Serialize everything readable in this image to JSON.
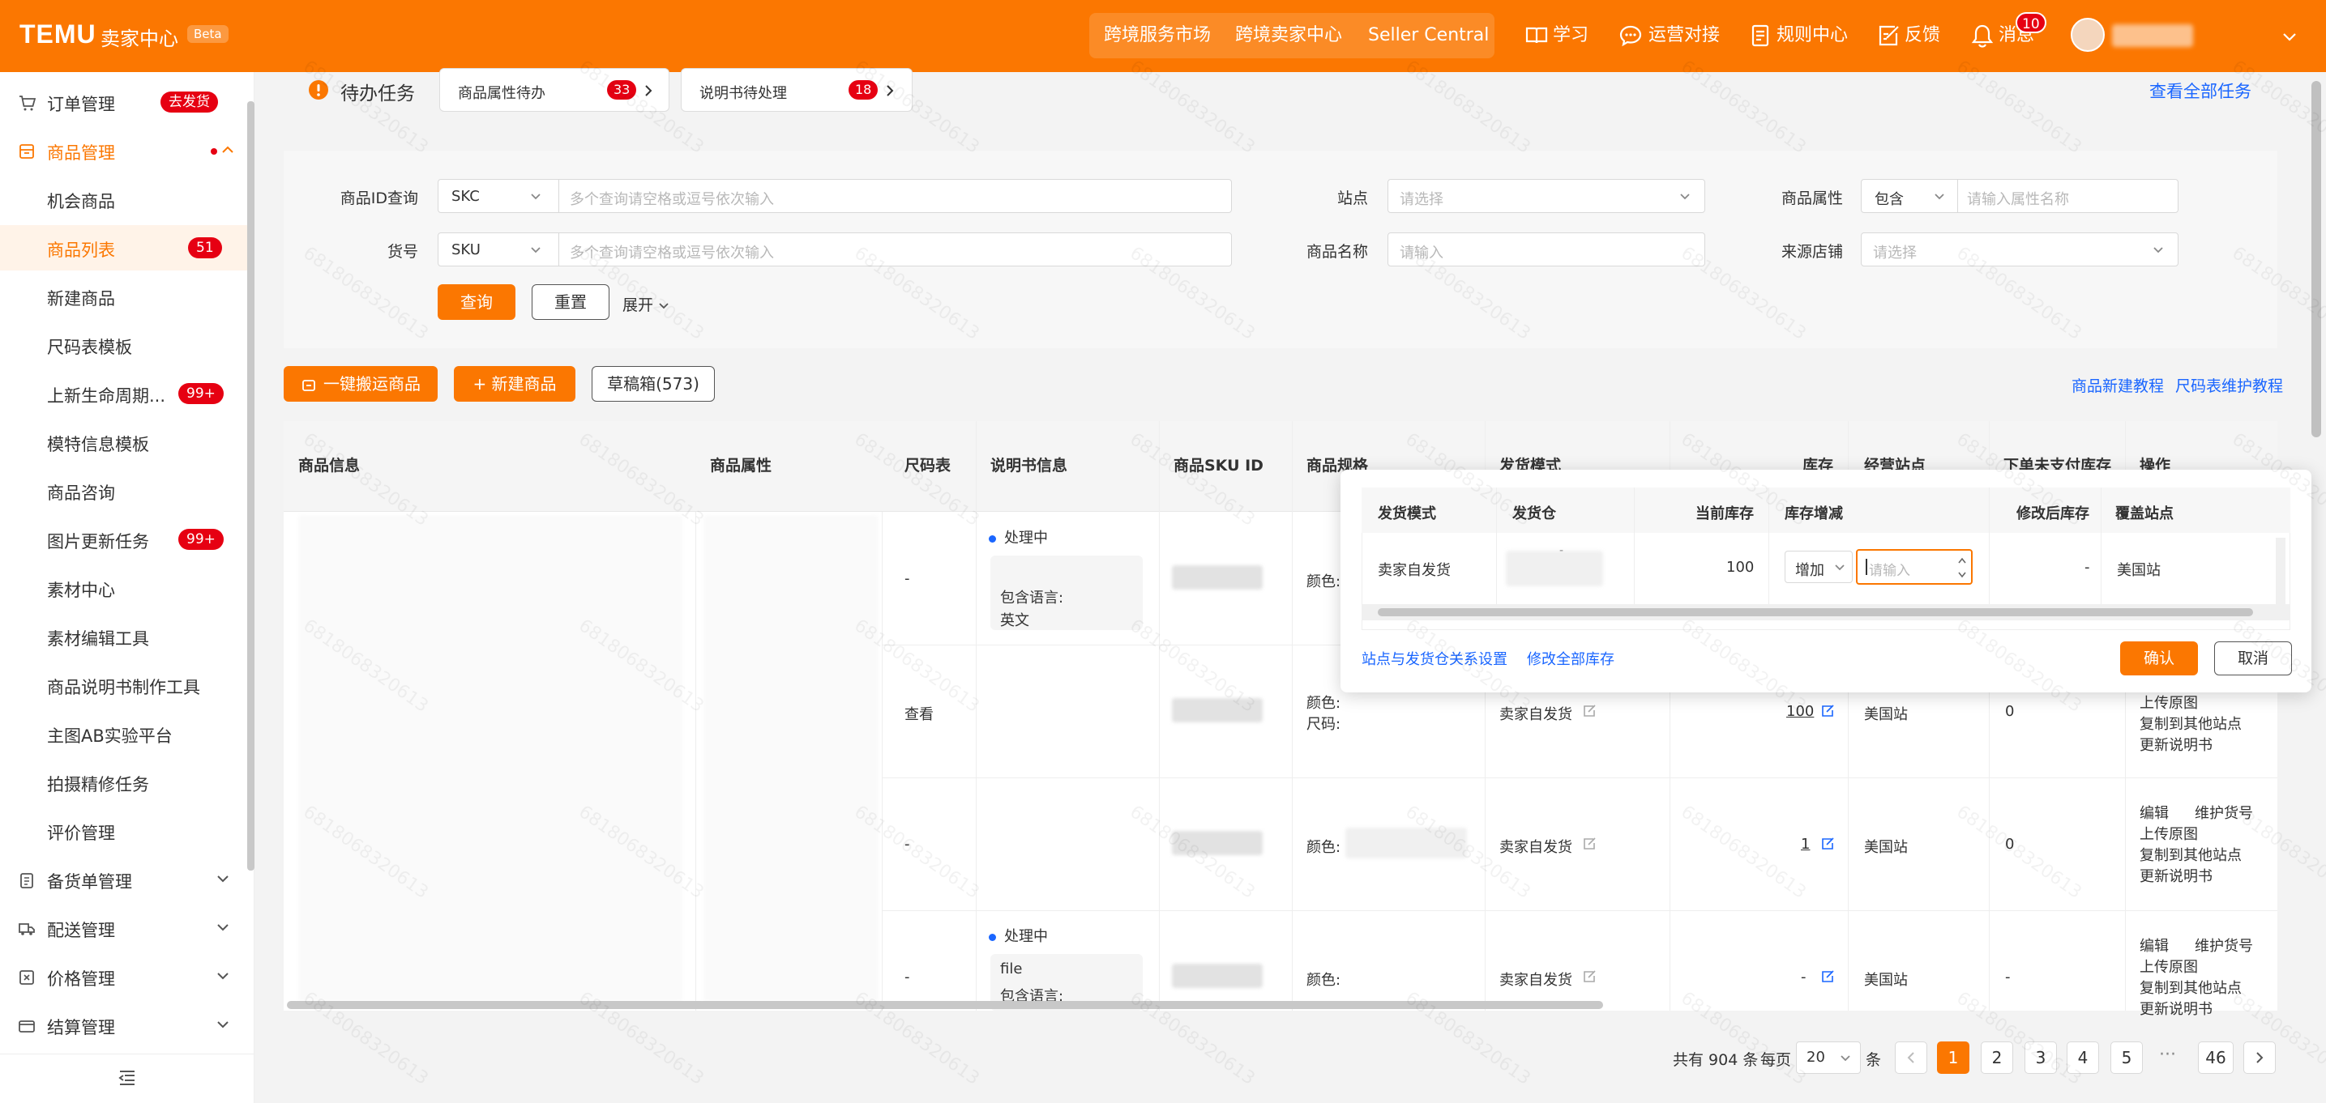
{
  "brand": {
    "logo": "TEMU",
    "subtitle": "卖家中心",
    "badge": "Beta"
  },
  "topnav": {
    "markets": [
      "跨境服务市场",
      "跨境卖家中心",
      "Seller Central"
    ],
    "links": [
      {
        "label": "学习",
        "icon": "book-icon"
      },
      {
        "label": "运营对接",
        "icon": "chat-icon"
      },
      {
        "label": "规则中心",
        "icon": "rules-icon"
      },
      {
        "label": "反馈",
        "icon": "feedback-icon"
      },
      {
        "label": "消息",
        "icon": "bell-icon"
      }
    ],
    "notifications": "10"
  },
  "sidebar": {
    "order": {
      "label": "订单管理",
      "badge": "去发货"
    },
    "product": {
      "label": "商品管理"
    },
    "items": [
      {
        "label": "机会商品",
        "badge": ""
      },
      {
        "label": "商品列表",
        "badge": "51"
      },
      {
        "label": "新建商品",
        "badge": ""
      },
      {
        "label": "尺码表模板",
        "badge": ""
      },
      {
        "label": "上新生命周期...",
        "badge": "99+"
      },
      {
        "label": "模特信息模板",
        "badge": ""
      },
      {
        "label": "商品咨询",
        "badge": ""
      },
      {
        "label": "图片更新任务",
        "badge": "99+"
      },
      {
        "label": "素材中心",
        "badge": ""
      },
      {
        "label": "素材编辑工具",
        "badge": ""
      },
      {
        "label": "商品说明书制作工具",
        "badge": ""
      },
      {
        "label": "主图AB实验平台",
        "badge": ""
      },
      {
        "label": "拍摄精修任务",
        "badge": ""
      },
      {
        "label": "评价管理",
        "badge": ""
      }
    ],
    "groups": [
      "备货单管理",
      "配送管理",
      "价格管理",
      "结算管理"
    ]
  },
  "tasks": {
    "title": "待办任务",
    "buttons": [
      {
        "label": "商品属性待办",
        "count": "33"
      },
      {
        "label": "说明书待处理",
        "count": "18"
      }
    ],
    "view_all": "查看全部任务"
  },
  "filters": {
    "id_query": {
      "label": "商品ID查询",
      "type": "SKC",
      "placeholder": "多个查询请空格或逗号依次输入"
    },
    "item_no": {
      "label": "货号",
      "type": "SKU",
      "placeholder": "多个查询请空格或逗号依次输入"
    },
    "site": {
      "label": "站点",
      "placeholder": "请选择"
    },
    "name": {
      "label": "商品名称",
      "placeholder": "请输入"
    },
    "attr": {
      "label": "商品属性",
      "mode": "包含",
      "placeholder": "请输入属性名称"
    },
    "store": {
      "label": "来源店铺",
      "placeholder": "请选择"
    },
    "query": "查询",
    "reset": "重置",
    "expand": "展开"
  },
  "actions": {
    "move": "一键搬运商品",
    "create": "+ 新建商品",
    "drafts": "草稿箱(573)",
    "tutorial": "商品新建教程",
    "size_table": "尺码表维护教程"
  },
  "table": {
    "columns": [
      "商品信息",
      "商品属性",
      "尺码表",
      "说明书信息",
      "商品SKU ID",
      "商品规格",
      "发货模式",
      "库存",
      "经营站点",
      "下单未支付库存",
      "操作"
    ],
    "rows": [
      {
        "size": "-",
        "manual_status": "处理中",
        "manual_lang_label": "包含语言:",
        "manual_lang": "英文",
        "spec": [
          "颜色:"
        ]
      },
      {
        "size": "查看",
        "spec": [
          "颜色:",
          "尺码:"
        ],
        "mode": "卖家自发货",
        "stock": "100",
        "site": "美国站",
        "unpaid": "0",
        "ops": [
          "上传原图",
          "复制到其他站点",
          "更新说明书"
        ]
      },
      {
        "size": "-",
        "spec": [
          "颜色:"
        ],
        "mode": "卖家自发货",
        "stock": "1",
        "site": "美国站",
        "unpaid": "0",
        "ops": [
          "编辑",
          "维护货号",
          "上传原图",
          "复制到其他站点",
          "更新说明书"
        ]
      },
      {
        "size": "-",
        "manual_status": "处理中",
        "manual_file": "file",
        "manual_lang_label": "包含语言:",
        "spec": [
          "颜色:"
        ],
        "mode": "卖家自发货",
        "stock": "-",
        "site": "美国站",
        "unpaid": "-",
        "ops": [
          "编辑",
          "维护货号",
          "上传原图",
          "复制到其他站点",
          "更新说明书"
        ]
      }
    ]
  },
  "popup": {
    "columns": [
      "发货模式",
      "发货仓",
      "当前库存",
      "库存增减",
      "修改后库存",
      "覆盖站点"
    ],
    "row": {
      "mode": "卖家自发货",
      "warehouse": "-",
      "current": "100",
      "op": "增加",
      "placeholder": "请输入",
      "after": "-",
      "site": "美国站"
    },
    "link1": "站点与发货仓关系设置",
    "link2": "修改全部库存",
    "confirm": "确认",
    "cancel": "取消"
  },
  "pagination": {
    "total": "共有 904 条",
    "per_page_label": "每页",
    "per_page": "20",
    "unit": "条",
    "pages": [
      "1",
      "2",
      "3",
      "4",
      "5"
    ],
    "ellipsis": "···",
    "last": "46"
  },
  "watermark": "6818068320613",
  "colors": {
    "brand": "#fb7701",
    "link": "#1a66ff",
    "badge": "#e60012"
  }
}
